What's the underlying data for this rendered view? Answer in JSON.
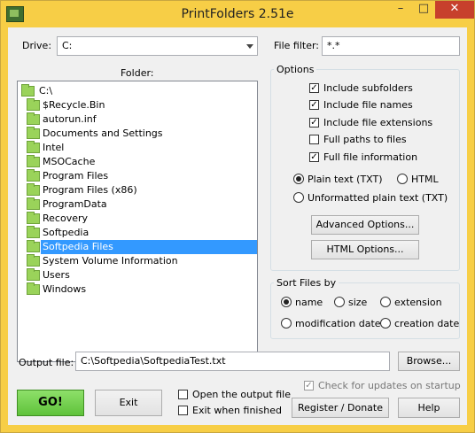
{
  "window": {
    "title": "PrintFolders 2.51e",
    "min": "–",
    "max": "□",
    "close": "✕"
  },
  "drive": {
    "label": "Drive:",
    "value": "C:"
  },
  "filter": {
    "label": "File filter:",
    "value": "*.*"
  },
  "folder": {
    "label": "Folder:",
    "root": "C:\\",
    "items": [
      "$Recycle.Bin",
      "autorun.inf",
      "Documents and Settings",
      "Intel",
      "MSOCache",
      "Program Files",
      "Program Files (x86)",
      "ProgramData",
      "Recovery",
      "Softpedia",
      "Softpedia Files",
      "System Volume Information",
      "Users",
      "Windows"
    ],
    "selected": "Softpedia Files"
  },
  "options": {
    "title": "Options",
    "include_subfolders": {
      "label": "Include subfolders",
      "checked": true
    },
    "include_file_names": {
      "label": "Include file names",
      "checked": true
    },
    "include_file_extensions": {
      "label": "Include file extensions",
      "checked": true
    },
    "full_paths": {
      "label": "Full paths to files",
      "checked": false
    },
    "full_file_info": {
      "label": "Full file information",
      "checked": true
    },
    "format_plain": {
      "label": "Plain text (TXT)",
      "selected": true
    },
    "format_html": {
      "label": "HTML",
      "selected": false
    },
    "format_unformatted": {
      "label": "Unformatted plain text (TXT)",
      "selected": false
    },
    "advanced_button": "Advanced Options...",
    "html_button": "HTML Options..."
  },
  "sort": {
    "title": "Sort Files by",
    "name": {
      "label": "name",
      "selected": true
    },
    "size": {
      "label": "size",
      "selected": false
    },
    "extension": {
      "label": "extension",
      "selected": false
    },
    "modification": {
      "label": "modification date",
      "selected": false
    },
    "creation": {
      "label": "creation date",
      "selected": false
    }
  },
  "output": {
    "label": "Output file:",
    "value": "C:\\Softpedia\\SoftpediaTest.txt",
    "browse_button": "Browse..."
  },
  "actions": {
    "go_button": "GO!",
    "exit_button": "Exit",
    "open_output": {
      "label": "Open the output file",
      "checked": false
    },
    "exit_when_finished": {
      "label": "Exit when finished",
      "checked": false
    },
    "check_updates": {
      "label": "Check for updates on startup",
      "checked": true
    },
    "register_button": "Register / Donate",
    "help_button": "Help"
  },
  "colors": {
    "title_bar": "#f7ce46",
    "selection": "#3399ff",
    "go_button": "#6fcf4a",
    "folder_icon": "#9ad35a"
  }
}
